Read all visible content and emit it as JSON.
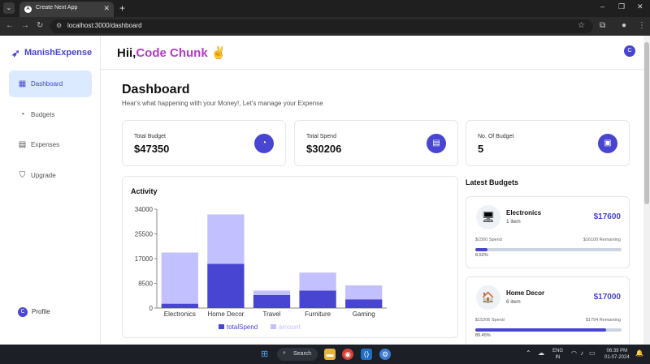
{
  "browser": {
    "tab_title": "Create Next App",
    "tab_favicon": "A",
    "url": "localhost:3000/dashboard",
    "new_tab": "+"
  },
  "sidebar": {
    "logo": "ManishExpense",
    "items": [
      {
        "label": "Dashboard",
        "icon": "grid-icon"
      },
      {
        "label": "Budgets",
        "icon": "piggy-bank-icon"
      },
      {
        "label": "Expenses",
        "icon": "receipt-icon"
      },
      {
        "label": "Upgrade",
        "icon": "shield-icon"
      }
    ],
    "profile_label": "Profile",
    "profile_initial": "C"
  },
  "header": {
    "greeting": "Hii,",
    "user_name": "Code Chunk",
    "emoji": "✌",
    "avatar_initial": "C"
  },
  "main": {
    "title": "Dashboard",
    "subtitle": "Hear's what happening with your Money!, Let's manage your Expense",
    "cards": [
      {
        "label": "Total Budget",
        "value": "$47350",
        "icon": "piggy-bank-icon"
      },
      {
        "label": "Total Spend",
        "value": "$30206",
        "icon": "receipt-icon"
      },
      {
        "label": "No. Of Budget",
        "value": "5",
        "icon": "wallet-icon"
      }
    ],
    "activity_title": "Activity"
  },
  "chart_data": {
    "type": "bar",
    "stacked": true,
    "categories": [
      "Electronics",
      "Home Decor",
      "Travel",
      "Furniture",
      "Gaming"
    ],
    "series": [
      {
        "name": "totalSpend",
        "values": [
          1500,
          15206,
          4500,
          6000,
          3000
        ],
        "color": "#4845d2"
      },
      {
        "name": "amount",
        "values": [
          17600,
          17000,
          1500,
          6200,
          4800
        ],
        "color": "#c3c0ff"
      }
    ],
    "yticks": [
      "0",
      "8500",
      "17000",
      "25500",
      "34000"
    ],
    "ylim": [
      0,
      34000
    ],
    "legend": "bottom"
  },
  "latest_budgets": {
    "title": "Latest Budgets",
    "items": [
      {
        "name": "Electronics",
        "items": "1 item",
        "amount": "$17600",
        "spend": "$1500 Spend",
        "remaining": "$16100 Remaining",
        "percent": "8.52%",
        "progress": 8.52,
        "icon": "laptop-icon",
        "icon_char": "🖥"
      },
      {
        "name": "Home Decor",
        "items": "6 item",
        "amount": "$17000",
        "spend": "$15206 Spend",
        "remaining": "$1794 Remaining",
        "percent": "89.45%",
        "progress": 89.45,
        "icon": "house-icon",
        "icon_char": "🏠"
      }
    ]
  },
  "taskbar": {
    "search_label": "Search",
    "lang_top": "ENG",
    "lang_bottom": "IN",
    "time": "06:39 PM",
    "date": "01-07-2024"
  }
}
